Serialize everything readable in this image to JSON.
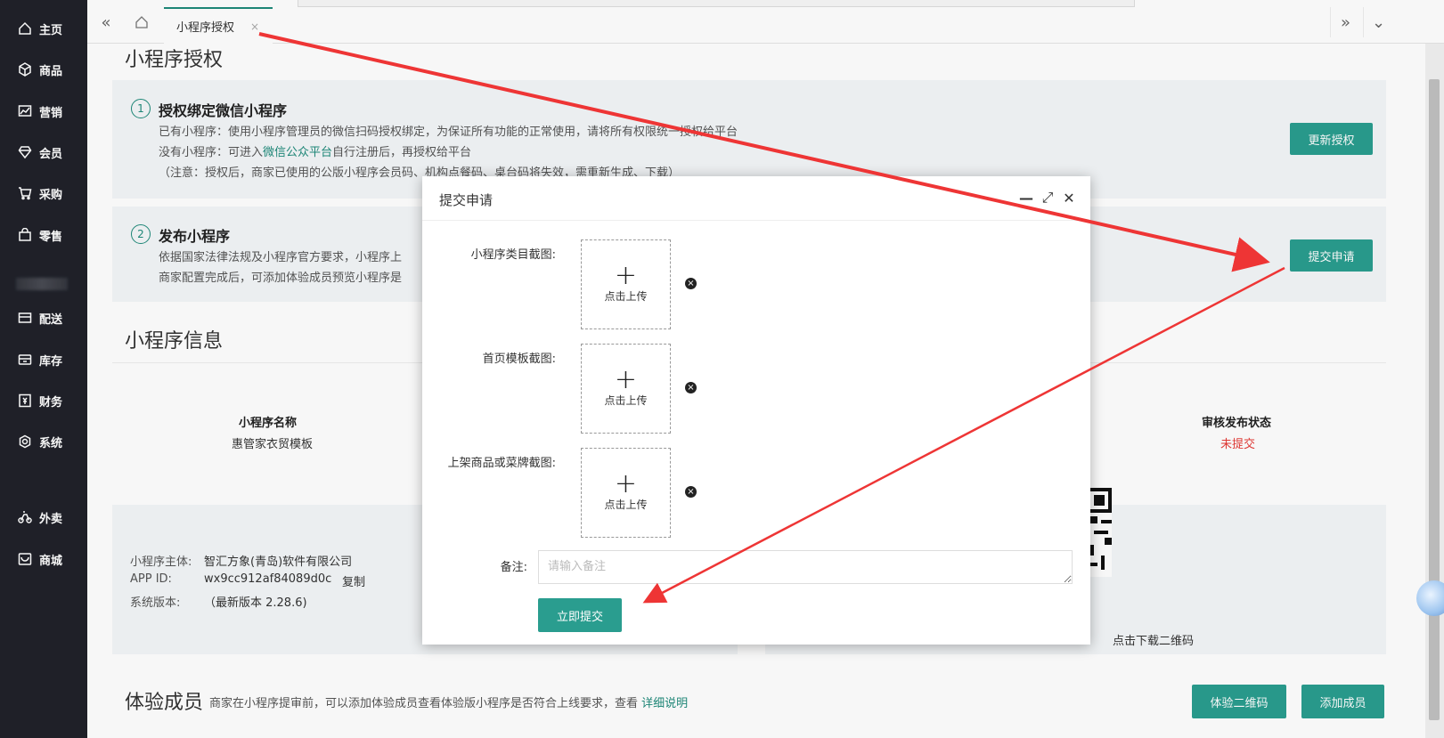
{
  "sidebar": {
    "items": [
      {
        "label": "主页",
        "icon": "home-icon"
      },
      {
        "label": "商品",
        "icon": "cube-icon"
      },
      {
        "label": "营销",
        "icon": "chart-icon"
      },
      {
        "label": "会员",
        "icon": "diamond-icon"
      },
      {
        "label": "采购",
        "icon": "cart-icon"
      },
      {
        "label": "零售",
        "icon": "bag-icon"
      },
      {
        "label": "配送",
        "icon": "truck-icon"
      },
      {
        "label": "库存",
        "icon": "box-icon"
      },
      {
        "label": "财务",
        "icon": "money-icon"
      },
      {
        "label": "系统",
        "icon": "gear-icon"
      },
      {
        "label": "外卖",
        "icon": "bike-icon"
      },
      {
        "label": "商城",
        "icon": "store-icon"
      }
    ]
  },
  "topbar": {
    "tab_label": "小程序授权",
    "tab_close": "×",
    "collapse_left": "«",
    "expand_right": "»",
    "dropdown": "⌄"
  },
  "page": {
    "title": "小程序授权",
    "step1": {
      "num": "1",
      "title": "授权绑定微信小程序",
      "line1": "已有小程序：使用小程序管理员的微信扫码授权绑定，为保证所有功能的正常使用，请将所有权限统一授权给平台",
      "line2_prefix": "没有小程序：可进入",
      "line2_link": "微信公众平台",
      "line2_suffix": "自行注册后，再授权给平台",
      "line3": "（注意：授权后，商家已使用的公版小程序会员码、机构点餐码、桌台码将失效，需重新生成、下载）",
      "button": "更新授权"
    },
    "step2": {
      "num": "2",
      "title": "发布小程序",
      "line1": "依据国家法律法规及小程序官方要求，小程序上",
      "line2": "商家配置完成后，可添加体验成员预览小程序是",
      "button": "提交申请"
    },
    "info": {
      "title": "小程序信息",
      "name_label": "小程序名称",
      "name_value": "惠管家衣贸模板",
      "status_label": "审核发布状态",
      "status_value": "未提交",
      "subject_label": "小程序主体:",
      "subject_value": "智汇方象(青岛)软件有限公司",
      "appid_label": "APP ID:",
      "appid_value": "wx9cc912af84089d0c",
      "appid_copy": "复制",
      "version_label": "系统版本:",
      "version_value": "（最新版本 2.28.6)",
      "qr_download": "点击下载二维码"
    },
    "members": {
      "title": "体验成员",
      "desc": "商家在小程序提审前，可以添加体验成员查看体验版小程序是否符合上线要求，查看",
      "desc_link": "详细说明",
      "btn_qr": "体验二维码",
      "btn_add": "添加成员"
    }
  },
  "modal": {
    "title": "提交申请",
    "field1_label": "小程序类目截图:",
    "field2_label": "首页模板截图:",
    "field3_label": "上架商品或菜牌截图:",
    "upload_plus": "+",
    "upload_text": "点击上传",
    "remove_glyph": "×",
    "remark_label": "备注:",
    "remark_placeholder": "请输入备注",
    "submit": "立即提交",
    "min_glyph": "—",
    "max_glyph": "⤢",
    "close_glyph": "✕"
  },
  "colors": {
    "accent": "#2a9d8f",
    "sidebar_bg": "#20222a",
    "status_red": "#e53935",
    "arrow_red": "#ee3535"
  }
}
